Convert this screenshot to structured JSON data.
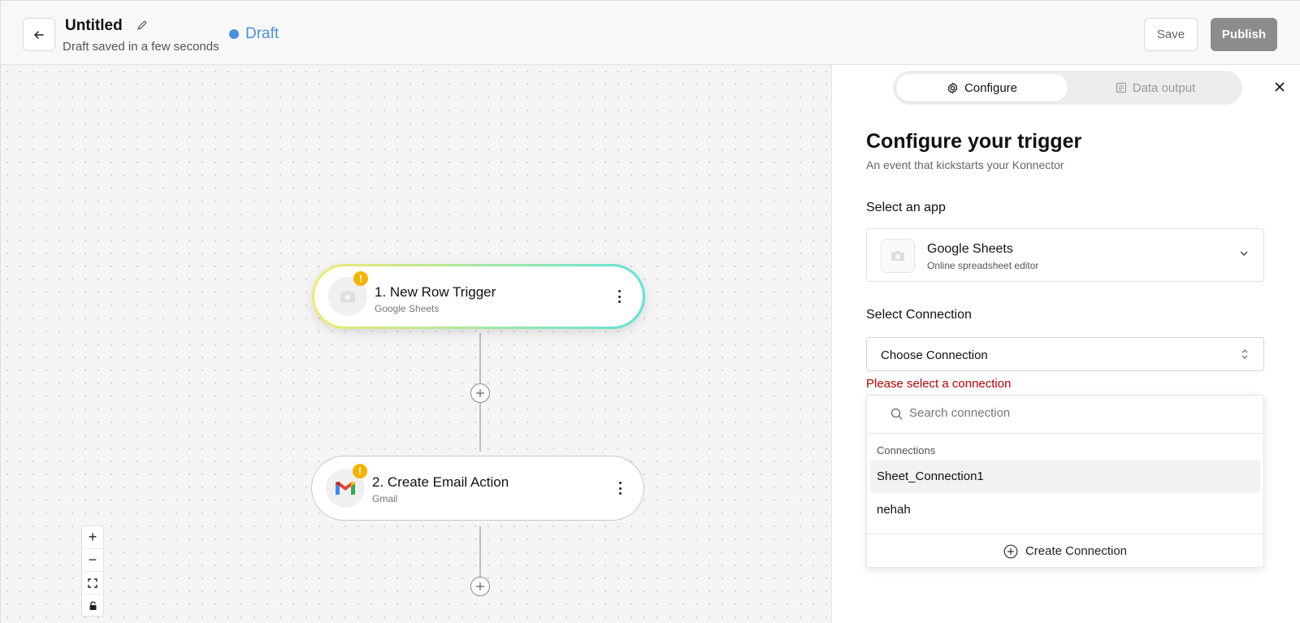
{
  "header": {
    "title": "Untitled",
    "subtitle": "Draft saved in a few seconds",
    "status": "Draft",
    "save_label": "Save",
    "publish_label": "Publish"
  },
  "nodes": [
    {
      "title": "1. New Row Trigger",
      "subtitle": "Google Sheets",
      "icon": "camera-placeholder-icon",
      "warning": "!"
    },
    {
      "title": "2. Create Email Action",
      "subtitle": "Gmail",
      "icon": "gmail-logo",
      "warning": "!"
    }
  ],
  "zoom_controls": {
    "zoom_in": "+",
    "zoom_out": "−"
  },
  "panel": {
    "tabs": [
      {
        "label": "Configure",
        "icon": "gear-icon",
        "active": true
      },
      {
        "label": "Data output",
        "icon": "document-icon",
        "active": false
      }
    ],
    "title": "Configure your trigger",
    "subtitle": "An event that kickstarts your Konnector",
    "select_app_label": "Select an app",
    "app": {
      "name": "Google Sheets",
      "description": "Online spreadsheet editor"
    },
    "select_connection_label": "Select Connection",
    "connection_value": "Choose Connection",
    "error": "Please select a connection",
    "dropdown": {
      "search_placeholder": "Search connection",
      "group_label": "Connections",
      "items": [
        "Sheet_Connection1",
        "nehah"
      ],
      "create_label": "Create Connection"
    }
  },
  "colors": {
    "status_blue": "#4a90e2",
    "publish_bg": "#8c8c8c",
    "warning": "#f5b400",
    "error": "#b80000"
  }
}
